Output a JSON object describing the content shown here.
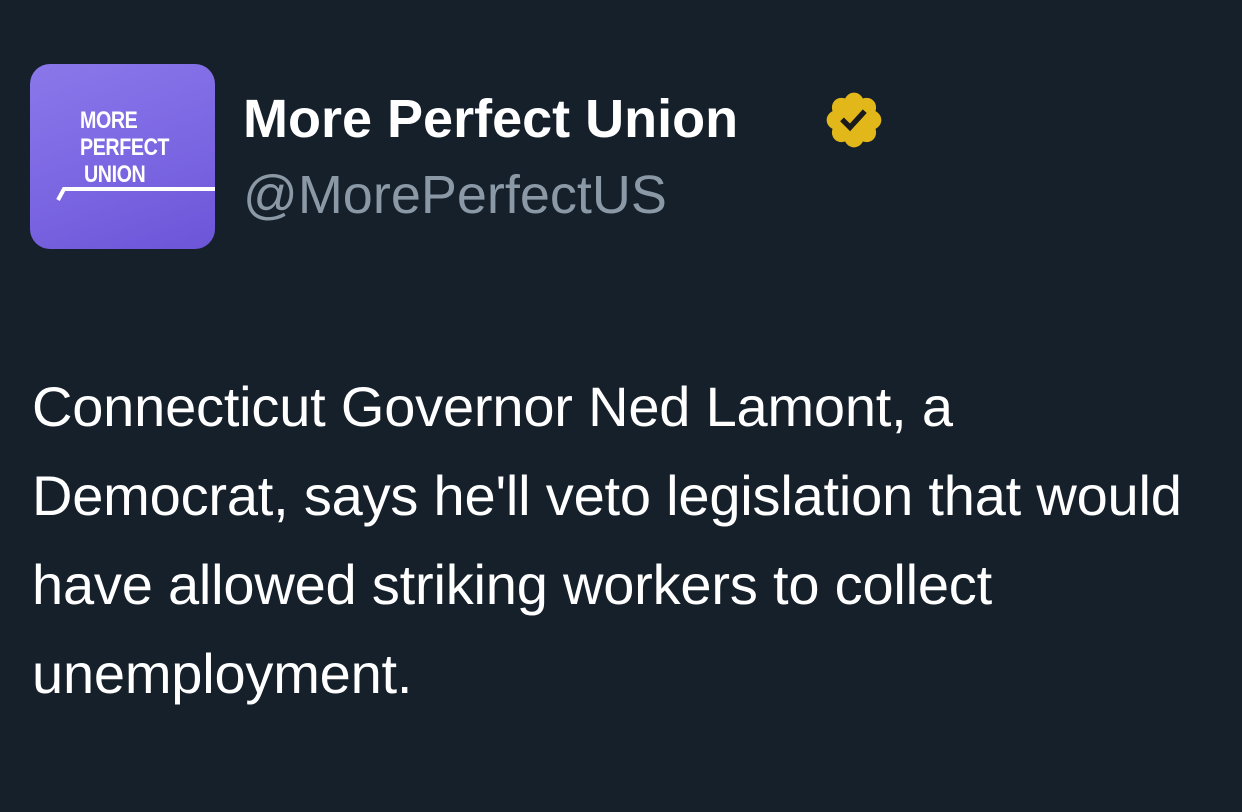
{
  "author": {
    "display_name": "More Perfect Union",
    "handle": "@MorePerfectUS",
    "avatar_text": [
      "MORE",
      "PERFECT",
      "UNION"
    ],
    "verified_icon": "verified-badge-icon"
  },
  "tweet": {
    "text": "Connecticut Governor Ned Lamont, a Democrat, says he'll veto legislation that would have allowed striking workers to collect unemployment."
  },
  "colors": {
    "background": "#15202b",
    "handle": "#8b98a5",
    "avatar": "#7b66e2",
    "badge": "#e2b719"
  }
}
